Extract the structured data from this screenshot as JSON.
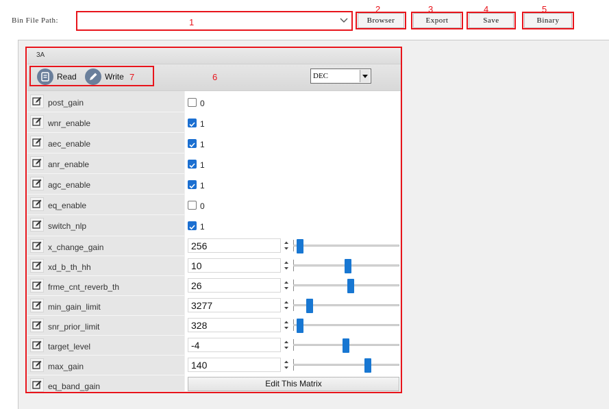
{
  "top": {
    "path_label": "Bin File Path:",
    "path_value": "",
    "buttons": [
      "Browser",
      "Export",
      "Save",
      "Binary"
    ]
  },
  "annotations": [
    "1",
    "2",
    "3",
    "4",
    "5",
    "6",
    "7"
  ],
  "group": {
    "title": "3A",
    "read_label": "Read",
    "write_label": "Write",
    "format_selected": "DEC"
  },
  "rows": [
    {
      "label": "post_gain",
      "type": "checkbox",
      "checked": false,
      "value": "0"
    },
    {
      "label": "wnr_enable",
      "type": "checkbox",
      "checked": true,
      "value": "1"
    },
    {
      "label": "aec_enable",
      "type": "checkbox",
      "checked": true,
      "value": "1"
    },
    {
      "label": "anr_enable",
      "type": "checkbox",
      "checked": true,
      "value": "1"
    },
    {
      "label": "agc_enable",
      "type": "checkbox",
      "checked": true,
      "value": "1"
    },
    {
      "label": "eq_enable",
      "type": "checkbox",
      "checked": false,
      "value": "0"
    },
    {
      "label": "switch_nlp",
      "type": "checkbox",
      "checked": true,
      "value": "1"
    },
    {
      "label": "x_change_gain",
      "type": "spin",
      "value": "256",
      "slider_fraction": 0.02
    },
    {
      "label": "xd_b_th_hh",
      "type": "spin",
      "value": "10",
      "slider_fraction": 0.5
    },
    {
      "label": "frme_cnt_reverb_th",
      "type": "spin",
      "value": "26",
      "slider_fraction": 0.53
    },
    {
      "label": "min_gain_limit",
      "type": "spin",
      "value": "3277",
      "slider_fraction": 0.12
    },
    {
      "label": "snr_prior_limit",
      "type": "spin",
      "value": "328",
      "slider_fraction": 0.02
    },
    {
      "label": "target_level",
      "type": "spin",
      "value": "-4",
      "slider_fraction": 0.48
    },
    {
      "label": "max_gain",
      "type": "spin",
      "value": "140",
      "slider_fraction": 0.7
    },
    {
      "label": "eq_band_gain",
      "type": "button",
      "value": "Edit This Matrix"
    }
  ],
  "colors": {
    "highlight": "#e8141b",
    "accent": "#1877d2"
  }
}
